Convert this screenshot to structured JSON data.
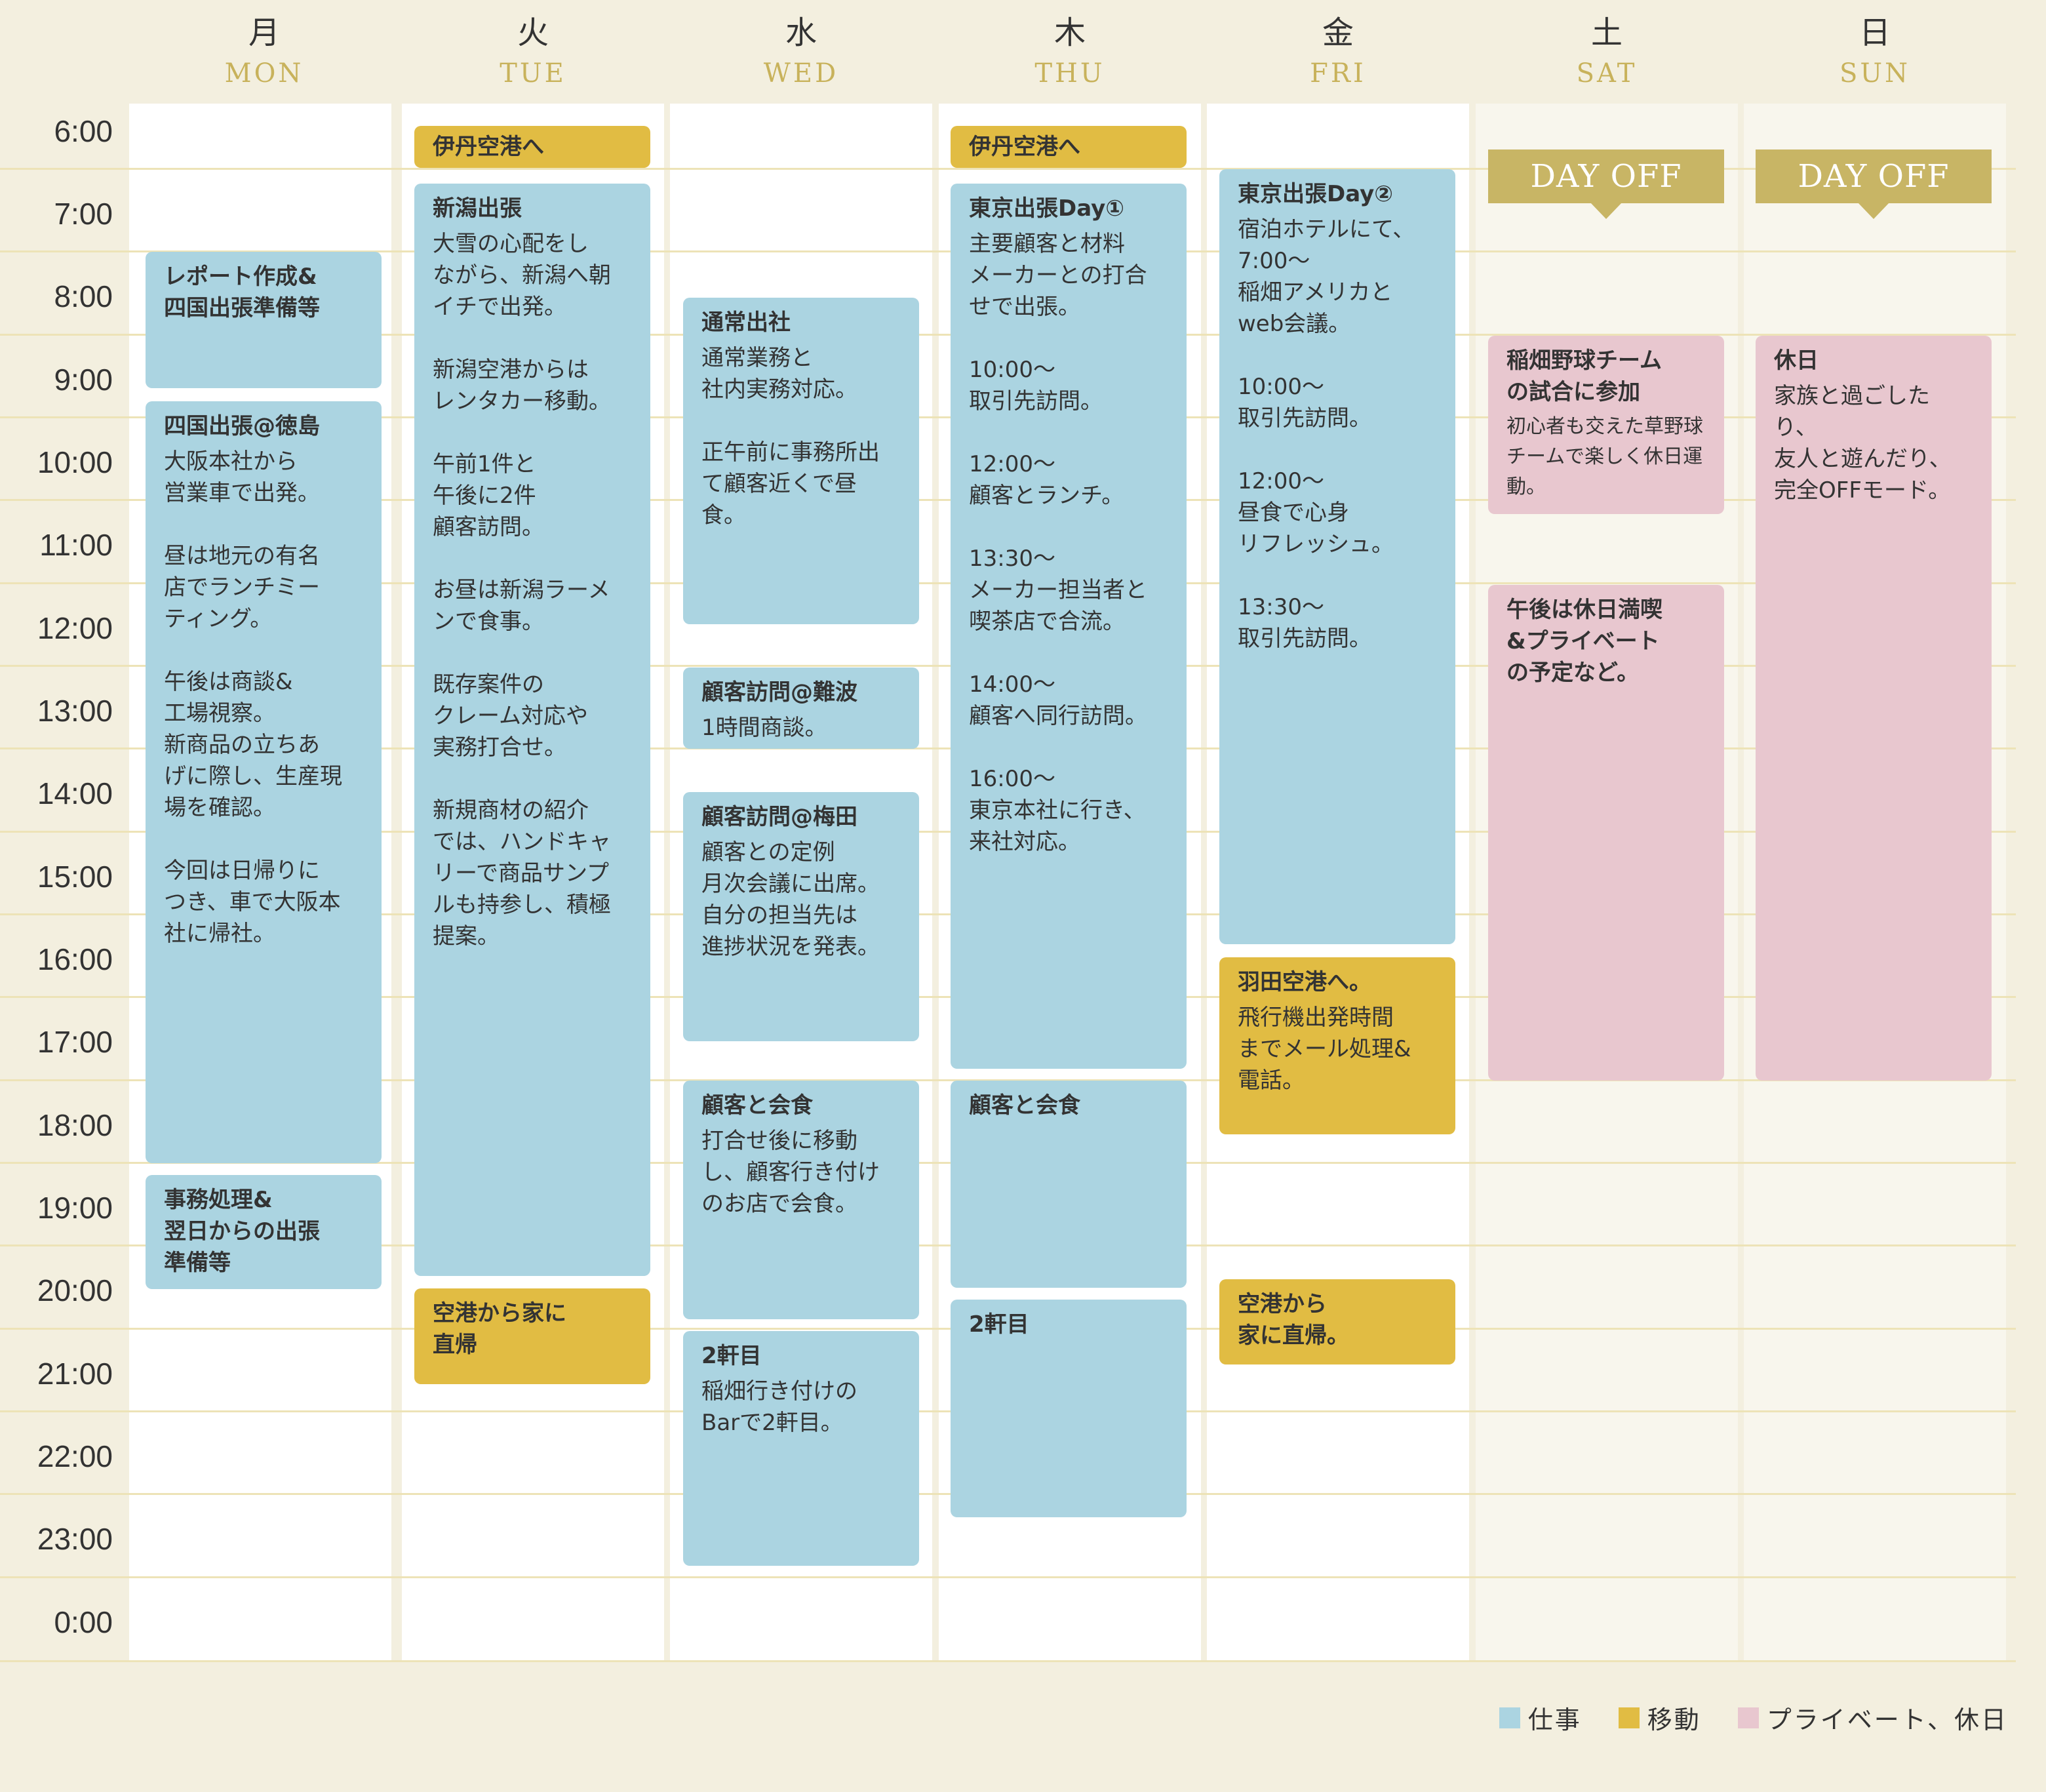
{
  "days": [
    {
      "jp": "月",
      "en": "MON"
    },
    {
      "jp": "火",
      "en": "TUE"
    },
    {
      "jp": "水",
      "en": "WED"
    },
    {
      "jp": "木",
      "en": "THU"
    },
    {
      "jp": "金",
      "en": "FRI"
    },
    {
      "jp": "土",
      "en": "SAT"
    },
    {
      "jp": "日",
      "en": "SUN"
    }
  ],
  "times": [
    "6:00",
    "7:00",
    "8:00",
    "9:00",
    "10:00",
    "11:00",
    "12:00",
    "13:00",
    "14:00",
    "15:00",
    "16:00",
    "17:00",
    "18:00",
    "19:00",
    "20:00",
    "21:00",
    "22:00",
    "23:00",
    "0:00"
  ],
  "day_off_label": "DAY OFF",
  "events": {
    "mon": [
      {
        "title": "レポート作成&\n四国出張準備等"
      },
      {
        "title": "四国出張@徳島",
        "desc": "大阪本社から\n営業車で出発。\n\n昼は地元の有名\n店でランチミー\nティング。\n\n午後は商談&\n工場視察。\n新商品の立ちあ\nげに際し、生産現\n場を確認。\n\n今回は日帰りに\nつき、車で大阪本\n社に帰社。"
      },
      {
        "title": "事務処理&\n翌日からの出張\n準備等"
      }
    ],
    "tue": [
      {
        "title": "伊丹空港へ"
      },
      {
        "title": "新潟出張",
        "desc": "大雪の心配をし\nながら、新潟へ朝\nイチで出発。\n\n新潟空港からは\nレンタカー移動。\n\n午前1件と\n午後に2件\n顧客訪問。\n\nお昼は新潟ラーメ\nンで食事。\n\n既存案件の\nクレーム対応や\n実務打合せ。\n\n新規商材の紹介\nでは、ハンドキャ\nリーで商品サンプ\nルも持参し、積極\n提案。"
      },
      {
        "title": "空港から家に\n直帰"
      }
    ],
    "wed": [
      {
        "title": "通常出社",
        "desc": "通常業務と\n社内実務対応。\n\n正午前に事務所出\nて顧客近くで昼食。"
      },
      {
        "title": "顧客訪問@難波",
        "desc": "1時間商談。"
      },
      {
        "title": "顧客訪問@梅田",
        "desc": "顧客との定例\n月次会議に出席。\n自分の担当先は\n進捗状況を発表。"
      },
      {
        "title": "顧客と会食",
        "desc": "打合せ後に移動\nし、顧客行き付け\nのお店で会食。"
      },
      {
        "title": "2軒目",
        "desc": "稲畑行き付けの\nBarで2軒目。"
      }
    ],
    "thu": [
      {
        "title": "伊丹空港へ"
      },
      {
        "title": "東京出張Day①",
        "desc": "主要顧客と材料\nメーカーとの打合\nせで出張。\n\n10:00〜\n取引先訪問。\n\n12:00〜\n顧客とランチ。\n\n13:30〜\nメーカー担当者と\n喫茶店で合流。\n\n14:00〜\n顧客へ同行訪問。\n\n16:00〜\n東京本社に行き、\n来社対応。"
      },
      {
        "title": "顧客と会食"
      },
      {
        "title": "2軒目"
      }
    ],
    "fri": [
      {
        "title": "東京出張Day②",
        "desc": "宿泊ホテルにて、\n7:00〜\n稲畑アメリカと\nweb会議。\n\n10:00〜\n取引先訪問。\n\n12:00〜\n昼食で心身\nリフレッシュ。\n\n13:30〜\n取引先訪問。"
      },
      {
        "title": "羽田空港へ。",
        "desc": "飛行機出発時間\nまでメール処理&\n電話。"
      },
      {
        "title": "空港から\n家に直帰。"
      }
    ],
    "sat": [
      {
        "title": "稲畑野球チーム\nの試合に参加",
        "desc": "初心者も交えた草野球\nチームで楽しく休日運動。"
      },
      {
        "title": "午後は休日満喫\n&プライベート\nの予定など。"
      }
    ],
    "sun": [
      {
        "title": "休日",
        "desc": "家族と過ごしたり、\n友人と遊んだり、\n完全OFFモード。"
      }
    ]
  },
  "legend": [
    {
      "label": "仕事",
      "color": "#abd4e1"
    },
    {
      "label": "移動",
      "color": "#e1bc43"
    },
    {
      "label": "プライベート、休日",
      "color": "#e8c7cf"
    }
  ]
}
